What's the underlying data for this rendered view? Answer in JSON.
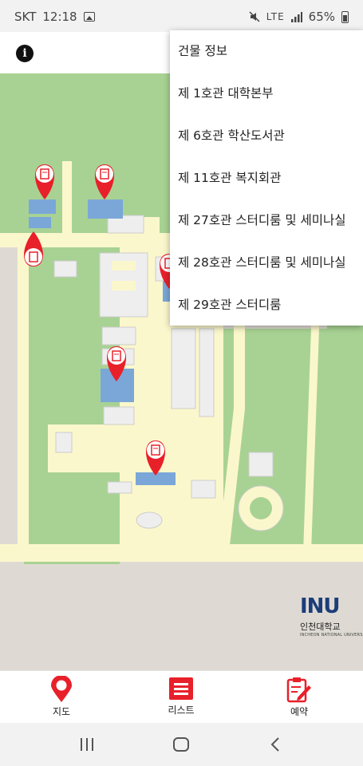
{
  "status_bar": {
    "carrier": "SKT",
    "time": "12:18",
    "signal_label": "LTE",
    "battery_percent": "65%",
    "icons": [
      "gallery-icon",
      "mute-icon",
      "lte-icon",
      "signal-icon",
      "battery-icon"
    ]
  },
  "app_bar": {
    "info_icon": "info-icon"
  },
  "dropdown": {
    "items": [
      "건물 정보",
      "제 1호관 대학본부",
      "제 6호관 학산도서관",
      "제 11호관 복지회관",
      "제 27호관 스터디룸 및 세미나실",
      "제 28호관 스터디룸 및 세미나실",
      "제 29호관 스터디룸"
    ]
  },
  "map": {
    "markers_icon": "book-marker-icon",
    "marker_count": 7,
    "logo": {
      "mark": "INU",
      "name": "인천대학교",
      "sub": "INCHEON NATIONAL UNIVERSITY"
    }
  },
  "bottom_nav": {
    "items": [
      {
        "label": "지도",
        "icon": "map-pin-icon"
      },
      {
        "label": "리스트",
        "icon": "list-icon"
      },
      {
        "label": "예약",
        "icon": "reservation-icon"
      }
    ]
  },
  "colors": {
    "accent": "#e8202a",
    "grass": "#a8d293",
    "road": "#fbf7cc",
    "building": "#eeeeee",
    "highlight_building": "#7aa7d8"
  }
}
